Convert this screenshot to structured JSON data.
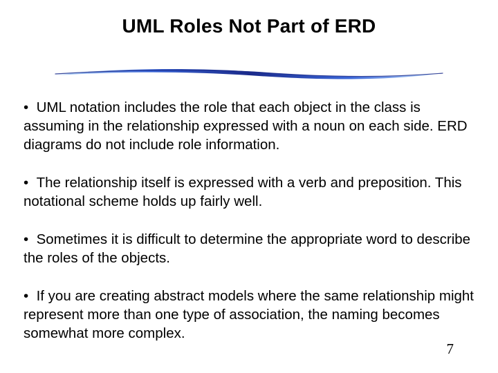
{
  "slide": {
    "title": "UML Roles Not Part of ERD",
    "bullets": [
      "UML notation includes the role that each object in the class is assuming in the relationship expressed with a noun on each side. ERD diagrams do not include role information.",
      "The relationship itself is expressed with a verb and preposition. This notational scheme holds up fairly well.",
      "Sometimes it is difficult to determine the appropriate word to describe the roles of the objects.",
      "If you are creating abstract models where the same relationship might represent more than one type of association, the naming becomes somewhat more complex."
    ],
    "bullet_marker": "•",
    "page_number": "7",
    "divider_colors": {
      "dark": "#1a2a8a",
      "mid": "#3a66d8",
      "light": "#aecdf5"
    }
  }
}
